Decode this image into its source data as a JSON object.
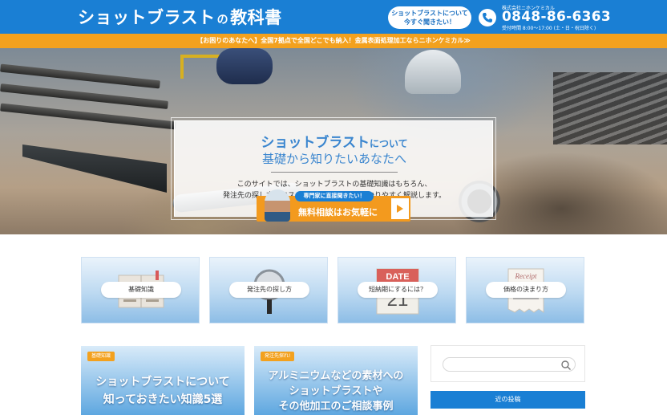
{
  "header": {
    "logo_main": "ショットブラスト",
    "logo_no": "の",
    "logo_tail": "教科書",
    "ask_line1": "ショットブラストについて",
    "ask_line2": "今すぐ聞きたい！",
    "company": "株式会社ニホンケミカル",
    "tel": "0848-86-6363",
    "hours": "受付時間 8:00〜17:00 (土・日・祝日除く)"
  },
  "announce": {
    "text": "【お困りのあなたへ】全国7拠点で全国どこでも納入！金属表面処理加工ならニホンケミカル≫"
  },
  "hero": {
    "line1_main": "ショットブラスト",
    "line1_small": "について",
    "line2": "基礎から知りたいあなたへ",
    "body1": "このサイトでは、ショットブラストの基礎知識はもちろん、",
    "body2": "発注先の探し方やコストカットの方法までわかりやすく解説します。",
    "cta_badge": "専門家に直接聞きたい！",
    "cta_label": "無料相談はお気軽に"
  },
  "cards": [
    {
      "label": "基礎知識"
    },
    {
      "label": "発注先の探し方"
    },
    {
      "label": "短納期にするには？"
    },
    {
      "label": "価格の決まり方"
    }
  ],
  "card_illus": {
    "date_word": "DATE",
    "date_num": "21",
    "receipt_word": "Receipt"
  },
  "articles": [
    {
      "tag": "基礎知識",
      "title1": "ショットブラストについて",
      "title2": "知っておきたい知識5選"
    },
    {
      "tag": "発注先探れ!",
      "title1": "アルミニウムなどの素材への",
      "title2": "ショットブラストや",
      "title3": "その他加工のご相談事例"
    }
  ],
  "sidebar": {
    "search_placeholder": "",
    "recent_label": "近の投稿"
  },
  "colors": {
    "brand_blue": "#1a7fd4",
    "accent_orange": "#f3a11e"
  },
  "icons": [
    "phone-icon",
    "search-icon",
    "play-arrow-icon"
  ]
}
